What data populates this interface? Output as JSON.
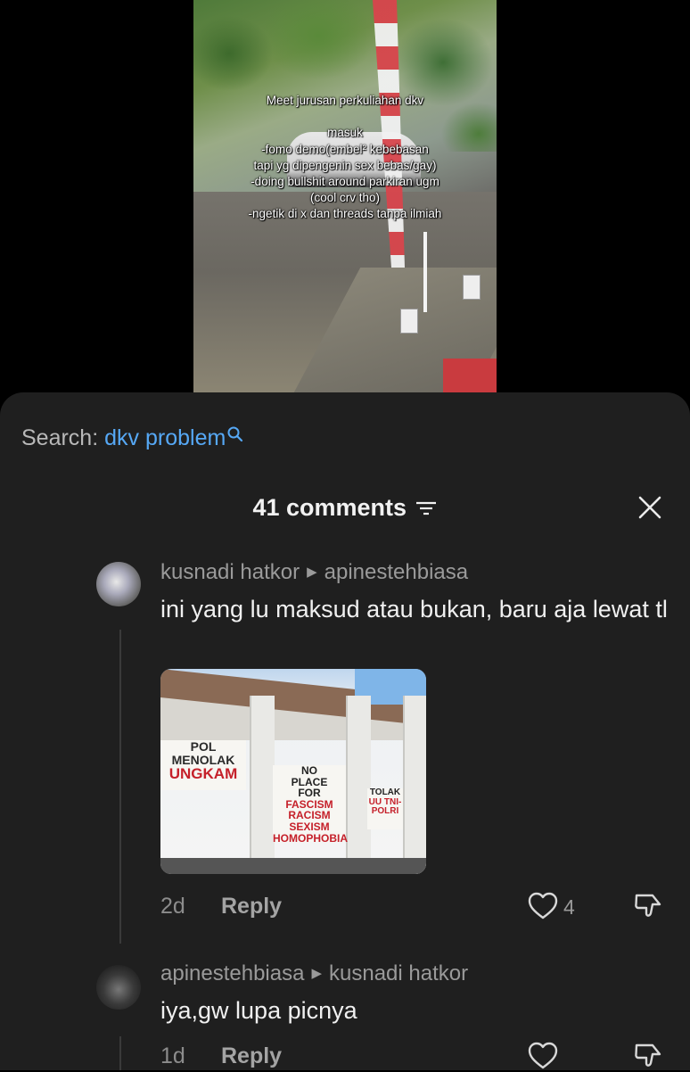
{
  "video": {
    "overlay_text": "Meet jurusan perkuliahan dkv\n\nmasuk\n-fomo demo(embel² kebebasan\ntapi yg dipengenin sex bebas/gay)\n-doing bullshit around parkiran ugm\n(cool crv tho)\n-ngetik di x dan threads tanpa ilmiah"
  },
  "search": {
    "label": "Search:",
    "keyword": "dkv problem",
    "icon": "search-icon"
  },
  "header": {
    "count_label": "41 comments",
    "filter_icon": "filter-icon",
    "close_icon": "close-icon"
  },
  "comments": [
    {
      "author": "kusnadi hatkor",
      "reply_to": "apinestehbiasa",
      "text": "ini yang lu maksud atau bukan, baru aja lewat tl",
      "has_image": true,
      "image_banners": [
        "POL MENOLAK",
        "UNGKAM",
        "NO",
        "PLACE",
        "FOR",
        "FASCISM",
        "RACISM",
        "SEXISM",
        "HOMOPHOBIA",
        "TOLAK",
        "UU TNI-POLRI"
      ],
      "time": "2d",
      "reply_label": "Reply",
      "likes": "4"
    },
    {
      "author": "apinestehbiasa",
      "reply_to": "kusnadi hatkor",
      "text": "iya,gw lupa picnya",
      "has_image": false,
      "time": "1d",
      "reply_label": "Reply",
      "likes": ""
    }
  ],
  "colors": {
    "sheet_bg": "#1f1f1f",
    "keyword_blue": "#56a8f5",
    "meta_gray": "#9a9a9a"
  }
}
